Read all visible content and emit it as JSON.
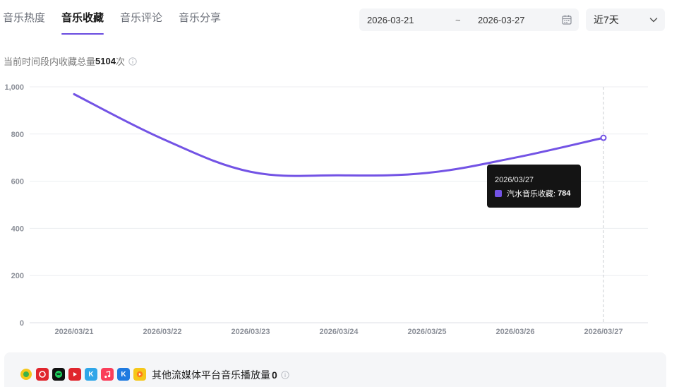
{
  "tabs": [
    {
      "label": "音乐热度",
      "active": false
    },
    {
      "label": "音乐收藏",
      "active": true
    },
    {
      "label": "音乐评论",
      "active": false
    },
    {
      "label": "音乐分享",
      "active": false
    }
  ],
  "date_picker": {
    "start": "2026-03-21",
    "separator": "~",
    "end": "2026-03-27",
    "icon": "calendar-icon"
  },
  "range_select": {
    "value": "近7天",
    "icon": "chevron-down-icon"
  },
  "summary": {
    "prefix": "当前时间段内收藏总量",
    "total": "5104",
    "suffix": "次",
    "icon": "info-icon"
  },
  "chart_data": {
    "type": "line",
    "x": [
      "2026/03/21",
      "2026/03/22",
      "2026/03/23",
      "2026/03/24",
      "2026/03/25",
      "2026/03/26",
      "2026/03/27"
    ],
    "series": [
      {
        "name": "汽水音乐收藏",
        "values": [
          969,
          780,
          640,
          625,
          635,
          700,
          784
        ],
        "color": "#7353e5"
      }
    ],
    "y_ticks": [
      "0",
      "200",
      "400",
      "600",
      "800",
      "1,000"
    ],
    "ylim": [
      0,
      1000
    ],
    "grid": true,
    "title": "",
    "xlabel": "",
    "ylabel": ""
  },
  "tooltip": {
    "date": "2026/03/27",
    "series_label": "汽水音乐收藏:",
    "value": "784"
  },
  "footer": {
    "platform_icons": [
      "kuwo-icon",
      "netease-music-icon",
      "qq-music-icon",
      "youtube-music-icon",
      "kugou-icon",
      "apple-music-icon",
      "kuaishou-icon",
      "other-music-icon"
    ],
    "label": "其他流媒体平台音乐播放量",
    "value": "0",
    "icon": "info-icon"
  },
  "colors": {
    "accent": "#7353e5",
    "tab_underline": "#6a4ce0"
  }
}
